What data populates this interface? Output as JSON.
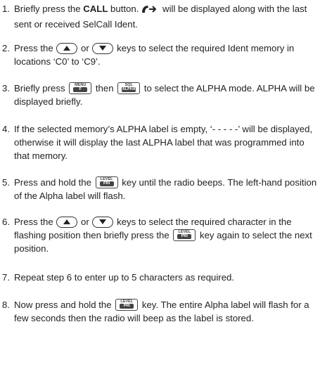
{
  "steps": [
    {
      "n": "1.",
      "a": "Briefly press the ",
      "b": "CALL",
      "c": " button.",
      "d": " will be displayed along with the last sent or received SelCall Ident."
    },
    {
      "n": "2.",
      "a": "Press the ",
      "b": " or ",
      "c": " keys to select the required Ident memory in locations ‘C0’ to ‘C9’."
    },
    {
      "n": "3.",
      "a": "Briefly press ",
      "b": " then ",
      "c": " to select the ALPHA mode. ALPHA will be displayed briefly."
    },
    {
      "n": "4.",
      "a": "If the selected memory’s ALPHA label is empty, ‘- - - - -’ will be displayed, otherwise it will display the last ALPHA label that was programmed into that memory."
    },
    {
      "n": "5.",
      "a": "Press and hold the ",
      "b": " key until the radio beeps. The left-hand position of the Alpha label will flash."
    },
    {
      "n": "6.",
      "a": "Press the ",
      "b": " or ",
      "c": " keys to select the required character in the flashing position then briefly press the ",
      "d": " key again to select the next position."
    },
    {
      "n": "7.",
      "a": "Repeat step 6 to enter up to 5 characters as required."
    },
    {
      "n": "8.",
      "a": "Now press and hold the ",
      "b": " key. The entire Alpha label will flash for a few seconds then the radio will beep as the label is stored."
    }
  ],
  "keys": {
    "menu_top": "MENU",
    "menu_bot": "F",
    "sql_top": "SQL",
    "sql_bot": "ALPHA",
    "level_top": "LEVEL",
    "level_bot": "PRI"
  }
}
